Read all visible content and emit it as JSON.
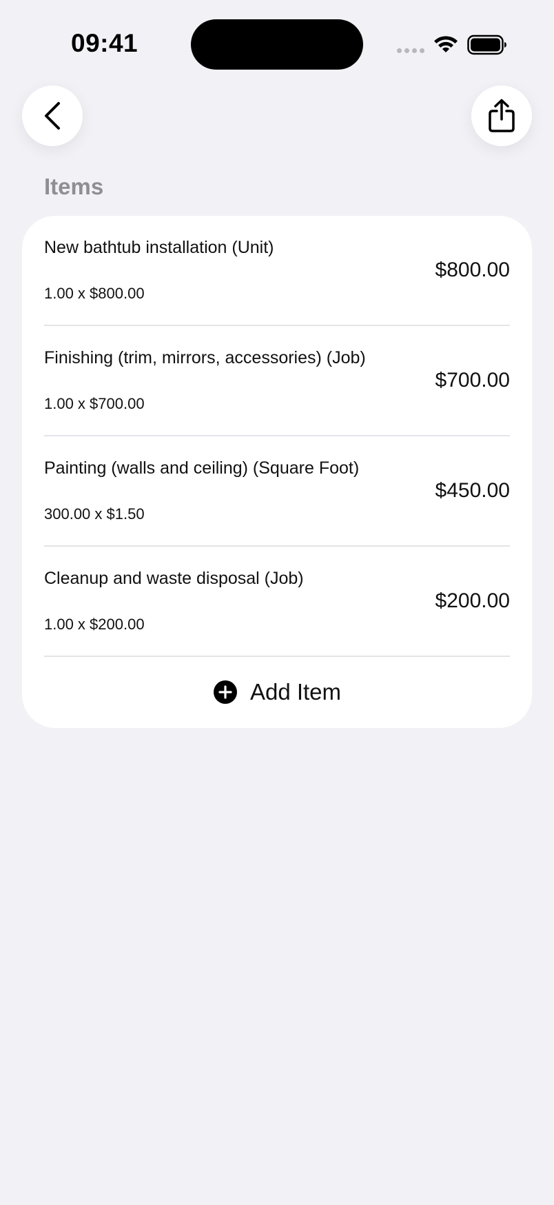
{
  "status_bar": {
    "time": "09:41"
  },
  "nav": {
    "back_icon": "chevron-left-icon",
    "share_icon": "share-icon"
  },
  "section": {
    "title": "Items"
  },
  "items": [
    {
      "title": "New bathtub installation (Unit)",
      "qty": "1.00 x $800.00",
      "amount": "$800.00"
    },
    {
      "title": "Finishing (trim, mirrors, accessories) (Job)",
      "qty": "1.00 x $700.00",
      "amount": "$700.00"
    },
    {
      "title": "Painting (walls and ceiling) (Square Foot)",
      "qty": "300.00 x $1.50",
      "amount": "$450.00"
    },
    {
      "title": "Cleanup and waste disposal (Job)",
      "qty": "1.00 x $200.00",
      "amount": "$200.00"
    }
  ],
  "add_item": {
    "label": "Add Item",
    "icon": "plus-circle-icon"
  },
  "colors": {
    "background": "#F1F1F6",
    "card": "#FFFFFF",
    "section_title": "#8E8E93",
    "divider": "#E4E4E8"
  }
}
